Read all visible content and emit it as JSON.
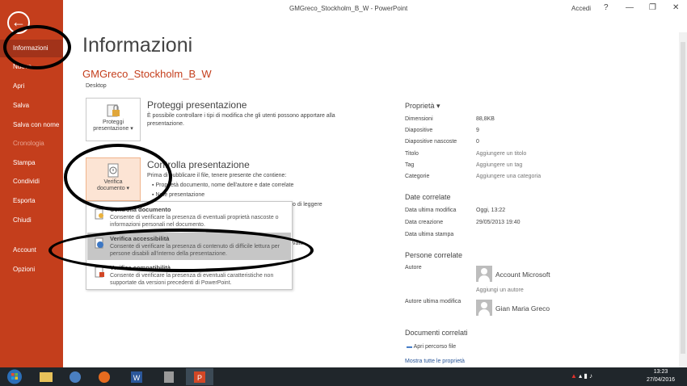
{
  "titlebar": {
    "title": "GMGreco_Stockholm_B_W - PowerPoint",
    "signin": "Accedi",
    "help": "?"
  },
  "sidebar": {
    "back_icon": "back-arrow-icon",
    "items": [
      {
        "label": "Informazioni"
      },
      {
        "label": "Nuovo"
      },
      {
        "label": "Apri"
      },
      {
        "label": "Salva"
      },
      {
        "label": "Salva con nome"
      },
      {
        "label": "Cronologia"
      },
      {
        "label": "Stampa"
      },
      {
        "label": "Condividi"
      },
      {
        "label": "Esporta"
      },
      {
        "label": "Chiudi"
      },
      {
        "label": "Account"
      },
      {
        "label": "Opzioni"
      }
    ]
  },
  "main": {
    "heading": "Informazioni",
    "file_name": "GMGreco_Stockholm_B_W",
    "file_location": "Desktop",
    "protect": {
      "button": "Proteggi",
      "button2": "presentazione ▾",
      "title": "Proteggi presentazione",
      "desc1": "È possibile controllare i tipi di modifica che gli utenti possono apportare alla",
      "desc2": "presentazione."
    },
    "inspect": {
      "button": "Verifica",
      "button2": "documento ▾",
      "title": "Controlla presentazione",
      "desc": "Prima di pubblicare il file, tenere presente che contiene:",
      "bullet1": "Proprietà documento, nome dell'autore e date correlate",
      "bullet2": "Note presentazione",
      "partial1": "o di leggere",
      "partial2": "vate"
    },
    "menu": [
      {
        "title": "Controlla documento",
        "desc": "Consente di verificare la presenza di eventuali proprietà nascoste o informazioni personali nel documento.",
        "icon": "inspect-document-icon"
      },
      {
        "title": "Verifica accessibilità",
        "desc": "Consente di verificare la presenza di contenuto di difficile lettura per persone disabili all'interno della presentazione.",
        "icon": "accessibility-check-icon"
      },
      {
        "title": "Verifica compatibilità",
        "desc": "Consente di verificare la presenza di eventuali caratteristiche non supportate da versioni precedenti di PowerPoint.",
        "icon": "compatibility-check-icon"
      }
    ]
  },
  "properties": {
    "heading": "Proprietà ▾",
    "rows": [
      {
        "label": "Dimensioni",
        "value": "88,8KB"
      },
      {
        "label": "Diapositive",
        "value": "9"
      },
      {
        "label": "Diapositive nascoste",
        "value": "0"
      },
      {
        "label": "Titolo",
        "value": "Aggiungere un titolo"
      },
      {
        "label": "Tag",
        "value": "Aggiungere un tag"
      },
      {
        "label": "Categorie",
        "value": "Aggiungere una categoria"
      }
    ],
    "dates_heading": "Date correlate",
    "dates": [
      {
        "label": "Data ultima modifica",
        "value": "Oggi, 13:22"
      },
      {
        "label": "Data creazione",
        "value": "29/05/2013 19:40"
      },
      {
        "label": "Data ultima stampa",
        "value": ""
      }
    ],
    "people_heading": "Persone correlate",
    "author_label": "Autore",
    "author_name": "Account Microsoft",
    "add_author": "Aggiungi un autore",
    "last_modified_label": "Autore ultima modifica",
    "last_modified_name": "Gian Maria Greco",
    "docs_heading": "Documenti correlati",
    "open_location": "Apri percorso file",
    "show_all": "Mostra tutte le proprietà"
  },
  "taskbar": {
    "time": "13:23",
    "date": "27/04/2016"
  },
  "colors": {
    "accent": "#c43e1c",
    "active_nav": "#a2331a",
    "taskbar": "#20262b"
  }
}
